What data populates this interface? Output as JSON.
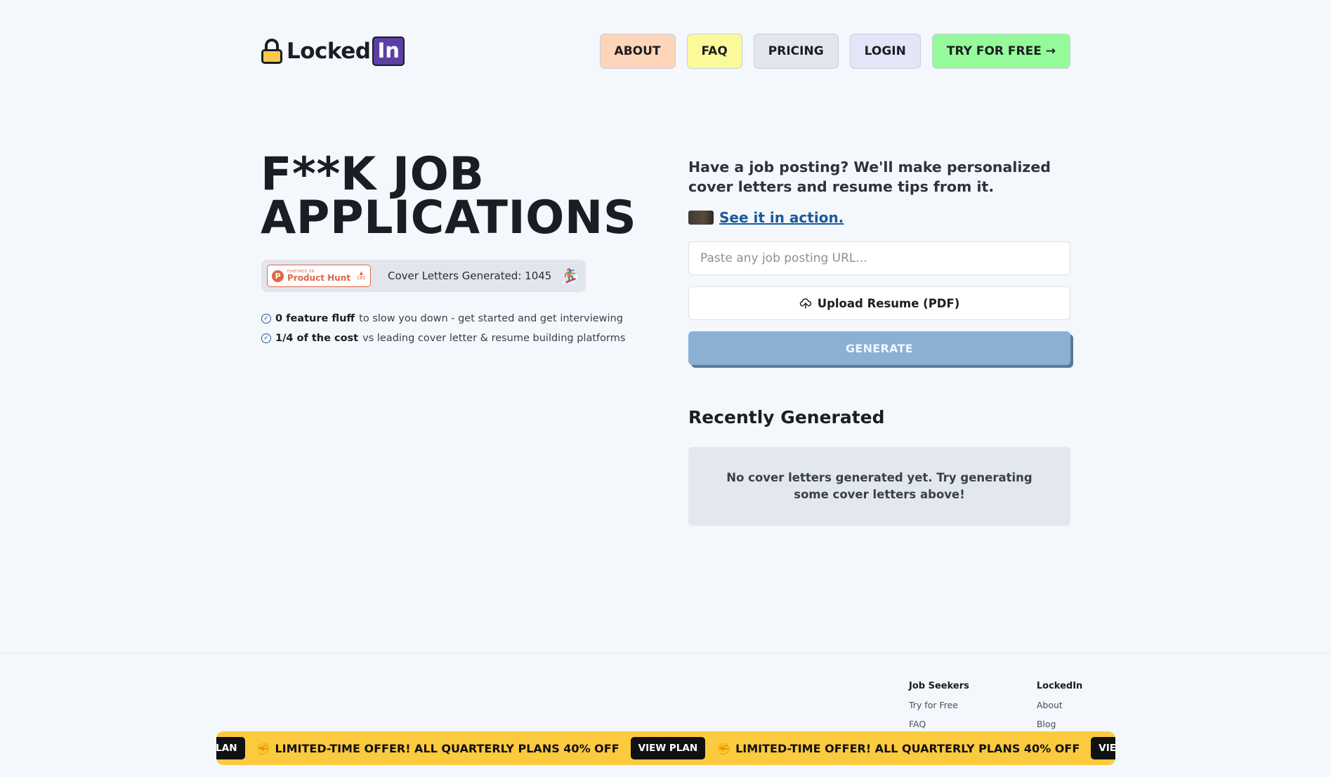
{
  "header": {
    "logo_word": "Locked",
    "logo_badge": "In",
    "nav": {
      "about": "ABOUT",
      "faq": "FAQ",
      "pricing": "PRICING",
      "login": "LOGIN",
      "try": "TRY FOR FREE →"
    }
  },
  "hero": {
    "title": "F**K JOB APPLICATIONS",
    "product_hunt": {
      "featured": "FEATURED ON",
      "name": "Product Hunt",
      "icon_letter": "P",
      "arrow": "▲",
      "votes": "181"
    },
    "stats_text": "Cover Letters Generated: 1045",
    "stats_emoji": "🏂",
    "features": [
      {
        "bold": "0 feature fluff",
        "rest": "to slow you down - get started and get interviewing"
      },
      {
        "bold": "1/4 of the cost",
        "rest": "vs leading cover letter & resume building platforms"
      }
    ]
  },
  "form": {
    "tagline": "Have a job posting? We'll make personalized cover letters and resume tips from it.",
    "see_action": "See it in action.",
    "url_placeholder": "Paste any job posting URL...",
    "upload_label": "Upload Resume (PDF)",
    "generate_label": "GENERATE"
  },
  "recent": {
    "title": "Recently Generated",
    "empty_text": "No cover letters generated yet. Try generating some cover letters above!"
  },
  "footer": {
    "col1": {
      "head": "Job Seekers",
      "links": [
        "Try for Free",
        "FAQ"
      ]
    },
    "col2": {
      "head": "LockedIn",
      "links": [
        "About",
        "Blog"
      ]
    }
  },
  "marquee": {
    "offer_text": "LIMITED-TIME OFFER! ALL QUARTERLY PLANS 40% OFF",
    "view_label": "VIEW PLAN",
    "icon": "✊"
  },
  "colors": {
    "background": "#f4f7fc",
    "brand_purple": "#5b3fa5",
    "generate_disabled": "#8ab0d4",
    "marquee": "#fbca3f",
    "try_green": "#95fb9a"
  }
}
